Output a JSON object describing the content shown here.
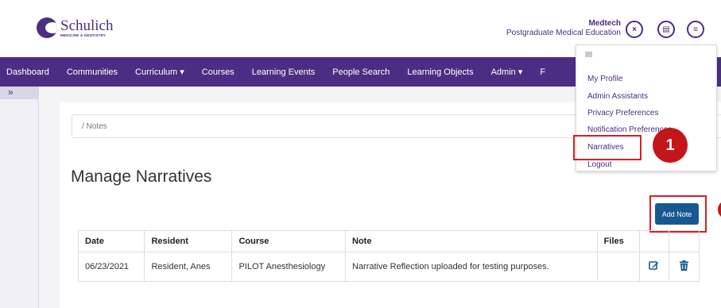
{
  "header": {
    "logo_name": "Schulich",
    "logo_sub": "MEDICINE & DENTISTRY",
    "user_name": "Medtech",
    "user_role": "Postgraduate Medical Education",
    "btn_close": "×",
    "btn_doc": "▤",
    "btn_menu": "≡"
  },
  "nav": [
    "Dashboard",
    "Communities",
    "Curriculum ▾",
    "Courses",
    "Learning Events",
    "People Search",
    "Learning Objects",
    "Admin ▾",
    "F"
  ],
  "sidebar": {
    "toggle": "»"
  },
  "breadcrumb": "/ Notes",
  "page_title": "Manage Narratives",
  "add_button": "Add Note",
  "table": {
    "headers": [
      "Date",
      "Resident",
      "Course",
      "Note",
      "Files",
      "",
      ""
    ],
    "rows": [
      {
        "date": "06/23/2021",
        "resident": "Resident, Anes",
        "course": "PILOT Anesthesiology",
        "note": "Narrative Reflection uploaded for testing purposes.",
        "files": ""
      }
    ]
  },
  "user_menu": {
    "items": [
      "My Profile",
      "Admin Assistants",
      "Privacy Preferences",
      "Notification Preferences",
      "Narratives",
      "Logout"
    ]
  },
  "step_badge": "1",
  "colors": {
    "brand": "#4b2e83",
    "button": "#175891",
    "highlight": "#d42028"
  }
}
